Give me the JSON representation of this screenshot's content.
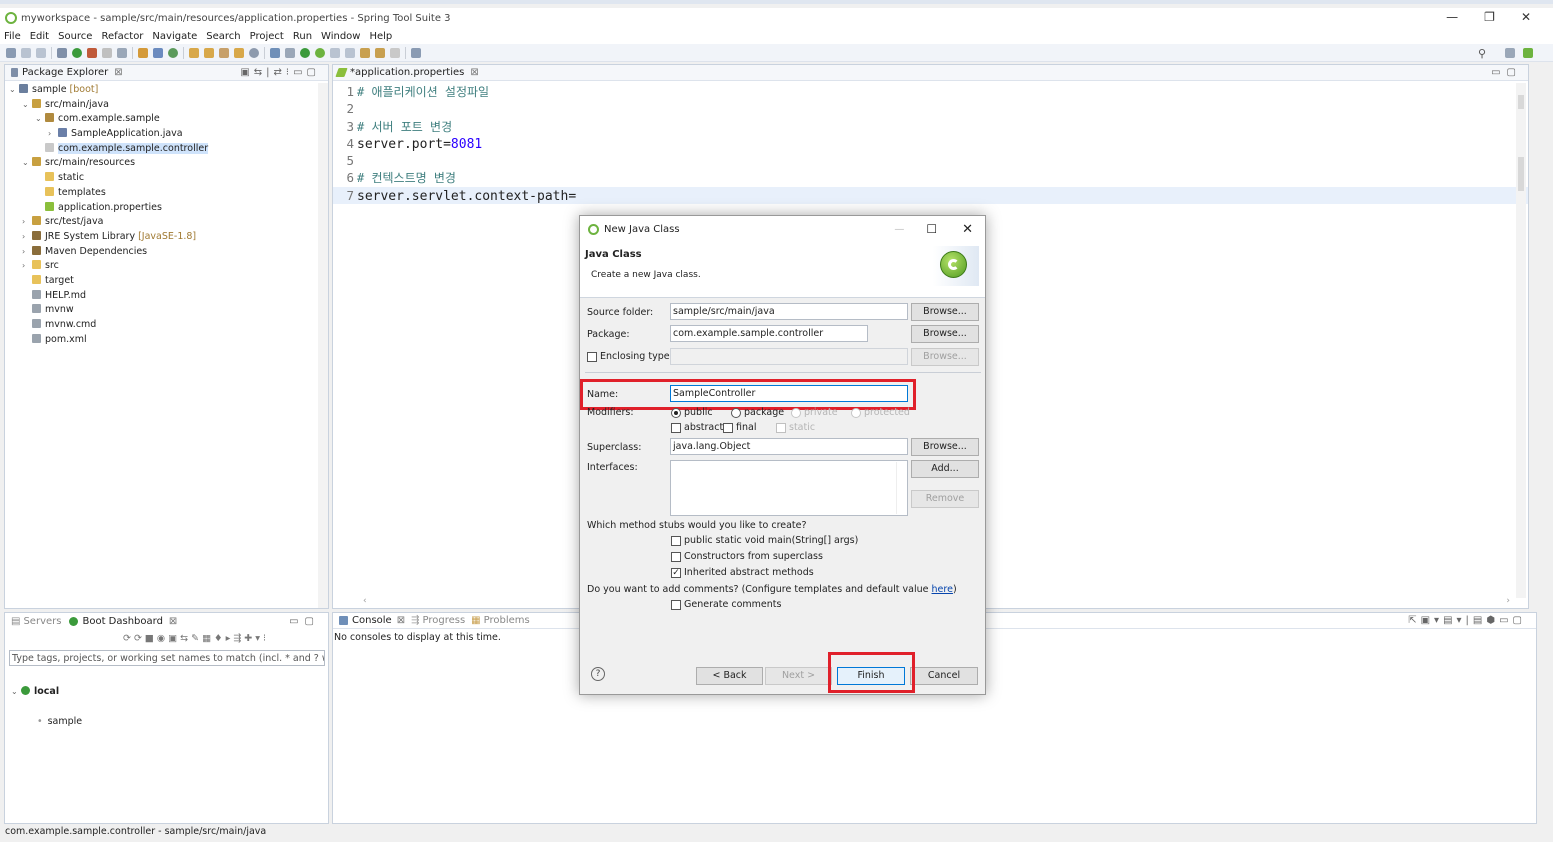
{
  "window": {
    "title": "myworkspace - sample/src/main/resources/application.properties - Spring Tool Suite 3",
    "minimize": "—",
    "restore": "❐",
    "close": "✕"
  },
  "menu": [
    "File",
    "Edit",
    "Source",
    "Refactor",
    "Navigate",
    "Search",
    "Project",
    "Run",
    "Window",
    "Help"
  ],
  "package_explorer": {
    "tab": "Package Explorer",
    "tree": [
      {
        "label": "sample",
        "decor": "[boot]",
        "indent": 0,
        "arrow": "⌄",
        "icon": "project-icon",
        "color": "#6b7f9e"
      },
      {
        "label": "src/main/java",
        "indent": 1,
        "arrow": "⌄",
        "icon": "source-folder-icon",
        "color": "#c8a040"
      },
      {
        "label": "com.example.sample",
        "indent": 2,
        "arrow": "⌄",
        "icon": "package-icon",
        "color": "#b08a3e"
      },
      {
        "label": "SampleApplication.java",
        "indent": 3,
        "arrow": "›",
        "icon": "java-file-icon",
        "color": "#6a7fa8"
      },
      {
        "label": "com.example.sample.controller",
        "indent": 2,
        "arrow": "",
        "icon": "package-icon",
        "color": "#c9c9c9",
        "selected": true
      },
      {
        "label": "src/main/resources",
        "indent": 1,
        "arrow": "⌄",
        "icon": "source-folder-icon",
        "color": "#c8a040"
      },
      {
        "label": "static",
        "indent": 2,
        "arrow": "",
        "icon": "folder-icon",
        "color": "#e8c25a"
      },
      {
        "label": "templates",
        "indent": 2,
        "arrow": "",
        "icon": "folder-icon",
        "color": "#e8c25a"
      },
      {
        "label": "application.properties",
        "indent": 2,
        "arrow": "",
        "icon": "properties-file-icon",
        "color": "#8bbf3c"
      },
      {
        "label": "src/test/java",
        "indent": 1,
        "arrow": "›",
        "icon": "source-folder-icon",
        "color": "#c8a040"
      },
      {
        "label": "JRE System Library",
        "decor": "[JavaSE-1.8]",
        "indent": 1,
        "arrow": "›",
        "icon": "library-icon",
        "color": "#8a6d3b"
      },
      {
        "label": "Maven Dependencies",
        "indent": 1,
        "arrow": "›",
        "icon": "library-icon",
        "color": "#8a6d3b"
      },
      {
        "label": "src",
        "indent": 1,
        "arrow": "›",
        "icon": "folder-icon",
        "color": "#e8c25a"
      },
      {
        "label": "target",
        "indent": 1,
        "arrow": "",
        "icon": "folder-icon",
        "color": "#e8c25a"
      },
      {
        "label": "HELP.md",
        "indent": 1,
        "arrow": "",
        "icon": "file-icon",
        "color": "#9aa3ad"
      },
      {
        "label": "mvnw",
        "indent": 1,
        "arrow": "",
        "icon": "file-icon",
        "color": "#9aa3ad"
      },
      {
        "label": "mvnw.cmd",
        "indent": 1,
        "arrow": "",
        "icon": "file-icon",
        "color": "#9aa3ad"
      },
      {
        "label": "pom.xml",
        "indent": 1,
        "arrow": "",
        "icon": "xml-file-icon",
        "color": "#9aa3ad"
      }
    ]
  },
  "editor": {
    "tab": "*application.properties",
    "lines": [
      {
        "n": "1",
        "type": "comment",
        "text": "# 애플리케이션 설정파일"
      },
      {
        "n": "2",
        "type": "blank",
        "text": ""
      },
      {
        "n": "3",
        "type": "comment",
        "text": "# 서버 포트 변경"
      },
      {
        "n": "4",
        "type": "prop",
        "key": "server.port=",
        "val": "8081"
      },
      {
        "n": "5",
        "type": "blank",
        "text": ""
      },
      {
        "n": "6",
        "type": "comment",
        "text": "# 컨텍스트명 변경"
      },
      {
        "n": "7",
        "type": "prop",
        "key": "server.servlet.context-path=",
        "val": "",
        "current": true
      }
    ]
  },
  "boot_dashboard": {
    "servers_tab": "Servers",
    "tab": "Boot Dashboard",
    "filter_placeholder": "Type tags, projects, or working set names to match (incl. * and ? wildcards)",
    "local": "local",
    "app": "sample"
  },
  "console": {
    "tab": "Console",
    "progress_tab": "Progress",
    "problems_tab": "Problems",
    "message": "No consoles to display at this time."
  },
  "status_bar": {
    "text": "com.example.sample.controller - sample/src/main/java"
  },
  "dialog": {
    "title": "New Java Class",
    "heading": "Java Class",
    "subheading": "Create a new Java class.",
    "source_folder_label": "Source folder:",
    "source_folder_value": "sample/src/main/java",
    "package_label": "Package:",
    "package_value": "com.example.sample.controller",
    "enclosing_label": "Enclosing type:",
    "name_label": "Name:",
    "name_value": "SampleController",
    "modifiers_label": "Modifiers:",
    "mod_public": "public",
    "mod_package": "package",
    "mod_private": "private",
    "mod_protected": "protected",
    "mod_abstract": "abstract",
    "mod_final": "final",
    "mod_static": "static",
    "superclass_label": "Superclass:",
    "superclass_value": "java.lang.Object",
    "interfaces_label": "Interfaces:",
    "browse": "Browse...",
    "add": "Add...",
    "remove": "Remove",
    "stubs_question": "Which method stubs would you like to create?",
    "stub_main": "public static void main(String[] args)",
    "stub_constructors": "Constructors from superclass",
    "stub_inherited": "Inherited abstract methods",
    "comments_question": "Do you want to add comments? (Configure templates and default value ",
    "comments_link": "here",
    "comments_close": ")",
    "generate_comments": "Generate comments",
    "help": "?",
    "back": "< Back",
    "next": "Next >",
    "finish": "Finish",
    "cancel": "Cancel"
  },
  "colors": {
    "accent": "#0078d7",
    "highlight_box": "#e0202a",
    "spring_green": "#6db33f"
  }
}
